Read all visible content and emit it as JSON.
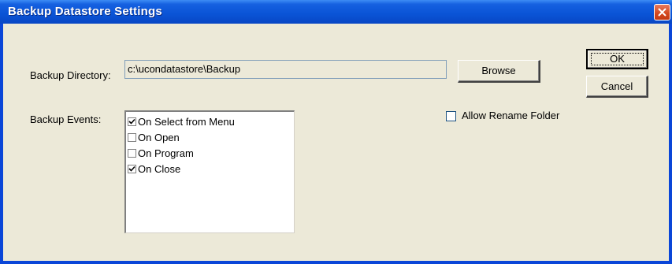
{
  "window": {
    "title": "Backup Datastore Settings"
  },
  "backup_directory": {
    "label": "Backup Directory:",
    "value": "c:\\ucondatastore\\Backup"
  },
  "buttons": {
    "browse": "Browse",
    "ok": "OK",
    "cancel": "Cancel"
  },
  "backup_events": {
    "label": "Backup Events:",
    "items": [
      {
        "label": "On Select from Menu",
        "checked": true
      },
      {
        "label": "On Open",
        "checked": false
      },
      {
        "label": "On Program",
        "checked": false
      },
      {
        "label": "On Close",
        "checked": true
      }
    ]
  },
  "allow_rename": {
    "label": "Allow Rename Folder",
    "checked": false
  },
  "colors": {
    "title_bar": "#0a54d6",
    "dialog_bg": "#ece9d8",
    "close_button": "#d3471e"
  }
}
